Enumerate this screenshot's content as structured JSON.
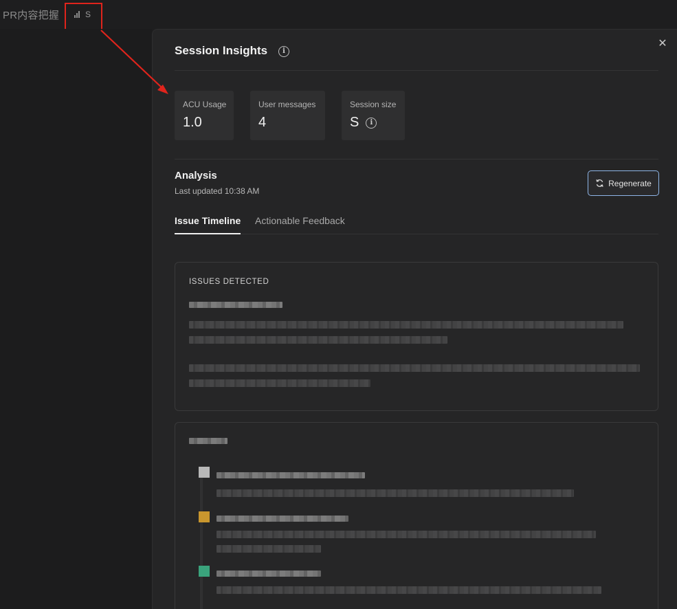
{
  "topbar": {
    "title": "PR内容把握",
    "size_chip_label": "S",
    "highlight_color": "#e0241c"
  },
  "panel": {
    "title": "Session Insights",
    "info_icon": "info-icon",
    "close_icon": "close-icon",
    "stats": [
      {
        "label": "ACU Usage",
        "value": "1.0"
      },
      {
        "label": "User messages",
        "value": "4"
      },
      {
        "label": "Session size",
        "value": "S",
        "icon": "info-icon"
      }
    ],
    "analysis": {
      "title": "Analysis",
      "last_updated": "Last updated 10:38 AM",
      "regenerate_label": "Regenerate",
      "regenerate_border_color": "#8fb6e8"
    },
    "tabs": [
      {
        "label": "Issue Timeline",
        "active": true
      },
      {
        "label": "Actionable Feedback",
        "active": false
      }
    ],
    "issues_card": {
      "heading": "ISSUES DETECTED"
    },
    "timeline": {
      "dot_colors": [
        "#b8b8b8",
        "#c9962e",
        "#3aa37c"
      ]
    }
  }
}
